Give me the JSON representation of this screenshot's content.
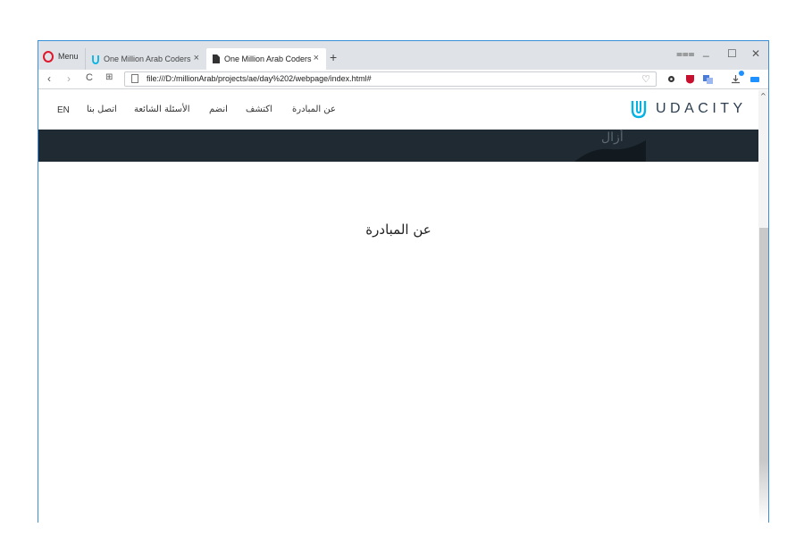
{
  "browser": {
    "menu_label": "Menu",
    "tabs": [
      {
        "title": "One Million Arab Coders",
        "close": "×"
      },
      {
        "title": "One Million Arab Coders",
        "close": "×"
      }
    ],
    "new_tab": "+",
    "address": "file:///D:/millionArab/projects/ae/day%202/webpage/index.html#",
    "window_controls": {
      "minimize": "_",
      "maximize": "☐",
      "close": "✕",
      "tabs_menu": "⩶"
    }
  },
  "site": {
    "logo_text": "UDACITY",
    "lang_toggle": "EN",
    "nav": [
      "عن المبادرة",
      "اكتشف",
      "انضم",
      "الأسئلة الشائعة",
      "اتصل بنا"
    ],
    "section_heading": "عن المبادرة",
    "hero_watermark": "أزال"
  },
  "colors": {
    "opera_red": "#e0182d",
    "udacity_blue": "#02b3e4",
    "hero_bg": "#1f2a33",
    "window_border": "#3a8fd8"
  }
}
